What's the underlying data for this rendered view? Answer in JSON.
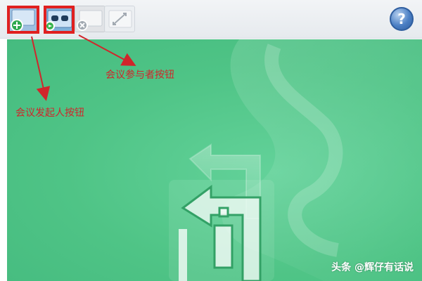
{
  "toolbar": {
    "buttons": [
      {
        "name": "initiator",
        "icon": "add-user-icon"
      },
      {
        "name": "participant",
        "icon": "participant-icon"
      },
      {
        "name": "close",
        "icon": "close-icon"
      },
      {
        "name": "expand",
        "icon": "expand-icon"
      }
    ],
    "help": {
      "icon": "help-icon",
      "label": "?"
    }
  },
  "annotations": {
    "initiator_label": "会议发起人按钮",
    "participant_label": "会议参与者按钮"
  },
  "watermark": "头条 @辉仔有话说",
  "colors": {
    "content_green": "#4fc486",
    "annotation_red": "#d0262b",
    "toolbar_gray": "#e6eaee"
  }
}
